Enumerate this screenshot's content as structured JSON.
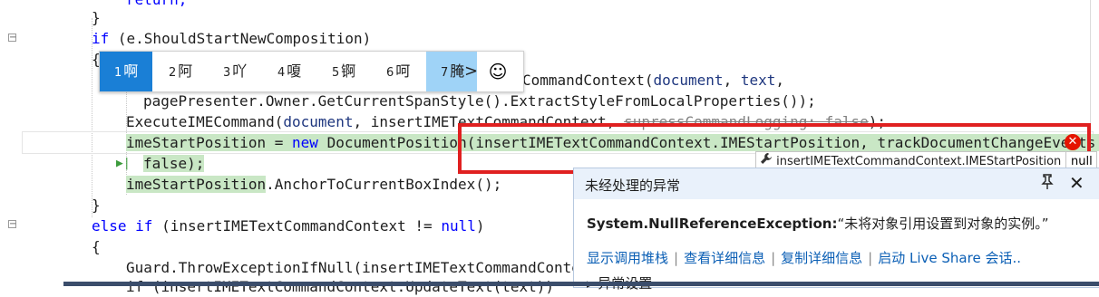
{
  "code_lines": {
    "l0": "return;",
    "l1": "}",
    "l2_kw": "if",
    "l2_rest": " (e.ShouldStartNewComposition)",
    "l3": "{",
    "l4_tail_a": "CommandContext(",
    "l4_tail_b": "document",
    "l4_tail_c": ", ",
    "l4_tail_d": "text",
    "l4_tail_e": ",",
    "l5": "pagePresenter.Owner.GetCurrentSpanStyle().ExtractStyleFromLocalProperties());",
    "l6_a": "ExecuteIMECommand(",
    "l6_b": "document",
    "l6_c": ", insertIMETextCommandContext, ",
    "l6_d": "supressCommandLogging: false",
    "l6_e": ");",
    "l7_a": "imeStartPosition = ",
    "l7_b": "new",
    "l7_c": " DocumentPosition(insertIMETextCommandContext.IMEStartPosition, trackDocumentChangeEvents:",
    "l8": "false);",
    "l9_a": "imeStartPosition",
    "l9_b": ".AnchorToCurrentBoxIndex();",
    "l10": "}",
    "l11_a": "else if",
    "l11_b": " (insertIMETextCommandContext != ",
    "l11_c": "null",
    "l11_d": ")",
    "l12": "{",
    "l13": "Guard.ThrowExceptionIfNull(insertIMETextCommandContex",
    "l14": "if (insertIMETextCommandContext.UpdateText(text))"
  },
  "ime": {
    "candidates": [
      {
        "num": "1",
        "text": "啊"
      },
      {
        "num": "2",
        "text": "阿"
      },
      {
        "num": "3",
        "text": "吖"
      },
      {
        "num": "4",
        "text": "嗄"
      },
      {
        "num": "5",
        "text": "锕"
      },
      {
        "num": "6",
        "text": "呵"
      },
      {
        "num": "7",
        "text": "腌"
      }
    ],
    "next_arrow": ">",
    "emoji": "☺"
  },
  "datatip": {
    "expression": "insertIMETextCommandContext.IMEStartPosition",
    "value": "null"
  },
  "exception": {
    "title": "未经处理的异常",
    "type": "System.NullReferenceException:",
    "message": "“未将对象引用设置到对象的实例。”",
    "links": [
      "显示调用堆栈",
      "查看详细信息",
      "复制详细信息",
      "启动 Live Share 会话.."
    ],
    "settings": "▸ 异常设置"
  },
  "colors": {
    "keyword": "#0000ff",
    "highlight": "#c9e7c5",
    "error_red": "#e51400",
    "link": "#0b5fb5"
  },
  "icons": [
    "fold-minus-icon",
    "error-icon",
    "wrench-icon",
    "pin-icon",
    "close-icon",
    "smiley-icon",
    "breakpoint-arrow-icon"
  ]
}
